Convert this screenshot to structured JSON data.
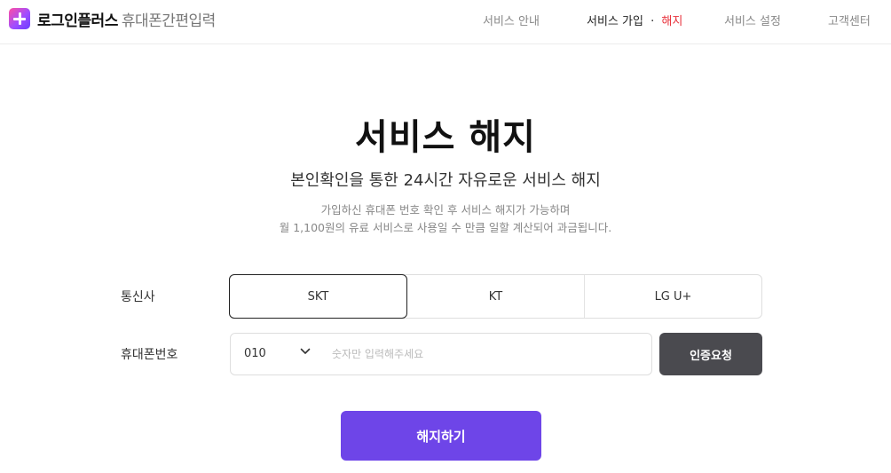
{
  "header": {
    "logo_icon": "plus-icon",
    "logo_name": "로그인플러스",
    "logo_sub": "휴대폰간편입력",
    "brand_gradient": [
      "#ff4fa3",
      "#a04dff",
      "#6a3dff"
    ],
    "nav": {
      "service_info": "서비스 안내",
      "join": "서비스 가입",
      "separator": "·",
      "cancel": "해지",
      "settings": "서비스 설정",
      "support": "고객센터"
    }
  },
  "main": {
    "title": "서비스 해지",
    "subtitle": "본인확인을 통한 24시간 자유로운 서비스 해지",
    "desc_line1": "가입하신 휴대폰 번호 확인 후 서비스 해지가 가능하며",
    "desc_line2": "월 1,100원의 유료 서비스로 사용일 수 만큼 일할 계산되어 과금됩니다."
  },
  "form": {
    "carrier_label": "통신사",
    "carriers": [
      "SKT",
      "KT",
      "LG U+"
    ],
    "selected_carrier": "SKT",
    "phone_label": "휴대폰번호",
    "phone_prefix": "010",
    "phone_placeholder": "숫자만 입력해주세요",
    "phone_value": "",
    "auth_button": "인증요청",
    "submit_button": "해지하기"
  },
  "colors": {
    "accent": "#6e45e8",
    "nav_highlight": "#e8303a",
    "auth_button": "#4a4a4f"
  }
}
